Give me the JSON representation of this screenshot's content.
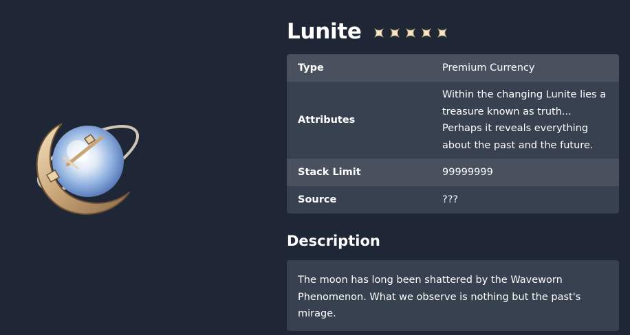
{
  "item": {
    "name": "Lunite",
    "rarity_stars": 5,
    "image_icon": "lunite-orb-icon"
  },
  "info": {
    "type_label": "Type",
    "type_value": "Premium Currency",
    "attributes_label": "Attributes",
    "attributes_value": "Within the changing Lunite lies a treasure known as truth... Perhaps it reveals everything about the past and the future.",
    "stack_label": "Stack Limit",
    "stack_value": "99999999",
    "source_label": "Source",
    "source_value": "???"
  },
  "description": {
    "heading": "Description",
    "text": "The moon has long been shattered by the Waveworn Phenomenon. What we observe is nothing but the past's mirage."
  },
  "colors": {
    "background": "#1f2736",
    "row_light": "#49505e",
    "row_dark": "#38414f",
    "star": "#f3e7c8"
  }
}
